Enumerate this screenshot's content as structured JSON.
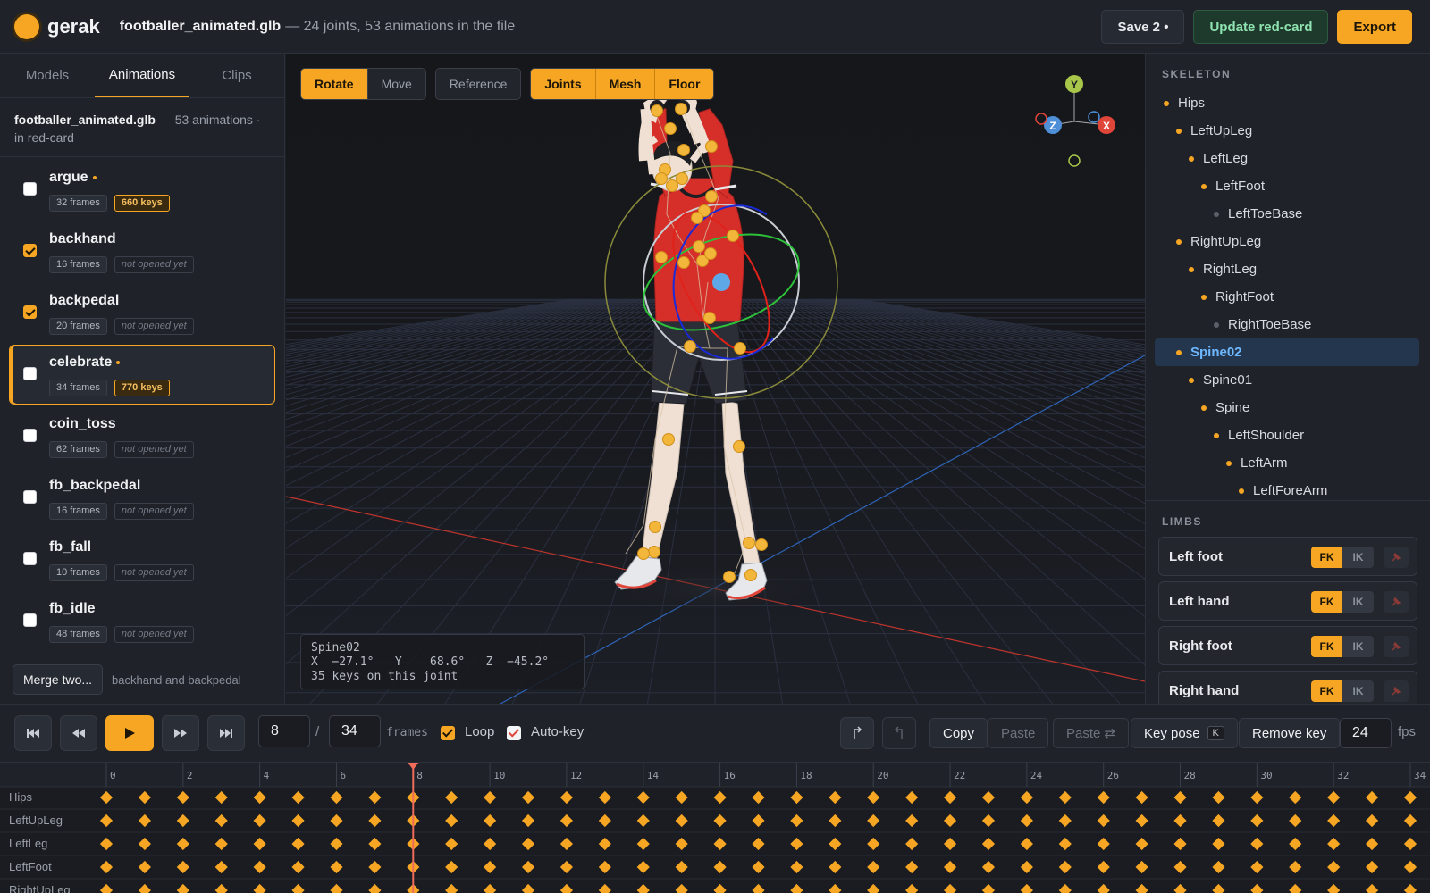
{
  "app": {
    "brand": "gerak"
  },
  "file": {
    "name": "footballer_animated.glb",
    "summary": "— 24 joints, 53 animations in the file"
  },
  "top_actions": {
    "save": "Save 2 •",
    "update": "Update red-card",
    "export": "Export"
  },
  "left": {
    "tabs": [
      "Models",
      "Animations",
      "Clips"
    ],
    "active_tab": 1,
    "file_name": "footballer_animated.glb",
    "file_meta_a": "— 53 animations ·",
    "file_meta_b": "in red-card",
    "animations": [
      {
        "name": "argue",
        "checked": false,
        "modified": true,
        "frames": "32 frames",
        "keys": "660 keys",
        "selected": false
      },
      {
        "name": "backhand",
        "checked": true,
        "modified": false,
        "frames": "16 frames",
        "keys": "not opened yet",
        "selected": false
      },
      {
        "name": "backpedal",
        "checked": true,
        "modified": false,
        "frames": "20 frames",
        "keys": "not opened yet",
        "selected": false
      },
      {
        "name": "celebrate",
        "checked": false,
        "modified": true,
        "frames": "34 frames",
        "keys": "770 keys",
        "selected": true
      },
      {
        "name": "coin_toss",
        "checked": false,
        "modified": false,
        "frames": "62 frames",
        "keys": "not opened yet",
        "selected": false
      },
      {
        "name": "fb_backpedal",
        "checked": false,
        "modified": false,
        "frames": "16 frames",
        "keys": "not opened yet",
        "selected": false
      },
      {
        "name": "fb_fall",
        "checked": false,
        "modified": false,
        "frames": "10 frames",
        "keys": "not opened yet",
        "selected": false
      },
      {
        "name": "fb_idle",
        "checked": false,
        "modified": false,
        "frames": "48 frames",
        "keys": "not opened yet",
        "selected": false
      }
    ],
    "merge_button": "Merge two...",
    "merge_hint": "backhand and backpedal"
  },
  "viewport": {
    "tool_group": [
      {
        "label": "Rotate",
        "on": true
      },
      {
        "label": "Move",
        "on": false
      }
    ],
    "reference": "Reference",
    "show_group": [
      {
        "label": "Joints",
        "on": true
      },
      {
        "label": "Mesh",
        "on": true
      },
      {
        "label": "Floor",
        "on": true
      }
    ],
    "gizmo_axes": {
      "x": "X",
      "y": "Y",
      "z": "Z"
    },
    "readout": {
      "joint": "Spine02",
      "rot": "X  −27.1°   Y    68.6°   Z  −45.2°",
      "keys": "35 keys on this joint"
    },
    "colors": {
      "accent": "#f6a623",
      "x_axis": "#e0453a",
      "y_axis": "#a8c64a",
      "z_axis": "#4e8fd8"
    }
  },
  "right": {
    "skeleton_title": "SKELETON",
    "skeleton": [
      {
        "name": "Hips",
        "depth": 0,
        "leaf": false,
        "selected": false
      },
      {
        "name": "LeftUpLeg",
        "depth": 1,
        "leaf": false,
        "selected": false
      },
      {
        "name": "LeftLeg",
        "depth": 2,
        "leaf": false,
        "selected": false
      },
      {
        "name": "LeftFoot",
        "depth": 3,
        "leaf": false,
        "selected": false
      },
      {
        "name": "LeftToeBase",
        "depth": 4,
        "leaf": true,
        "selected": false
      },
      {
        "name": "RightUpLeg",
        "depth": 1,
        "leaf": false,
        "selected": false
      },
      {
        "name": "RightLeg",
        "depth": 2,
        "leaf": false,
        "selected": false
      },
      {
        "name": "RightFoot",
        "depth": 3,
        "leaf": false,
        "selected": false
      },
      {
        "name": "RightToeBase",
        "depth": 4,
        "leaf": true,
        "selected": false
      },
      {
        "name": "Spine02",
        "depth": 1,
        "leaf": false,
        "selected": true
      },
      {
        "name": "Spine01",
        "depth": 2,
        "leaf": false,
        "selected": false
      },
      {
        "name": "Spine",
        "depth": 3,
        "leaf": false,
        "selected": false
      },
      {
        "name": "LeftShoulder",
        "depth": 4,
        "leaf": false,
        "selected": false
      },
      {
        "name": "LeftArm",
        "depth": 5,
        "leaf": false,
        "selected": false
      },
      {
        "name": "LeftForeArm",
        "depth": 6,
        "leaf": false,
        "selected": false
      }
    ],
    "limbs_title": "LIMBS",
    "limbs": [
      {
        "name": "Left foot",
        "fk": "FK",
        "ik": "IK"
      },
      {
        "name": "Left hand",
        "fk": "FK",
        "ik": "IK"
      },
      {
        "name": "Right foot",
        "fk": "FK",
        "ik": "IK"
      },
      {
        "name": "Right hand",
        "fk": "FK",
        "ik": "IK"
      }
    ]
  },
  "playback": {
    "current_frame": "8",
    "separator": "/",
    "total_frames": "34",
    "frames_label": "frames",
    "loop_label": "Loop",
    "loop_checked": true,
    "autokey_label": "Auto-key",
    "autokey_checked": true,
    "copy": "Copy",
    "paste": "Paste",
    "paste_mirror": "Paste ⇄",
    "key_pose": "Key pose",
    "key_pose_shortcut": "K",
    "remove_key": "Remove key",
    "fps_value": "24",
    "fps_label": "fps"
  },
  "timeline": {
    "ticks": [
      "0",
      "2",
      "4",
      "6",
      "8",
      "10",
      "12",
      "14",
      "16",
      "18",
      "20",
      "22",
      "24",
      "26",
      "28",
      "30",
      "32",
      "34"
    ],
    "playhead_frame": 8,
    "max_frame": 34,
    "tracks": [
      "Hips",
      "LeftUpLeg",
      "LeftLeg",
      "LeftFoot",
      "RightUpLeg"
    ]
  }
}
